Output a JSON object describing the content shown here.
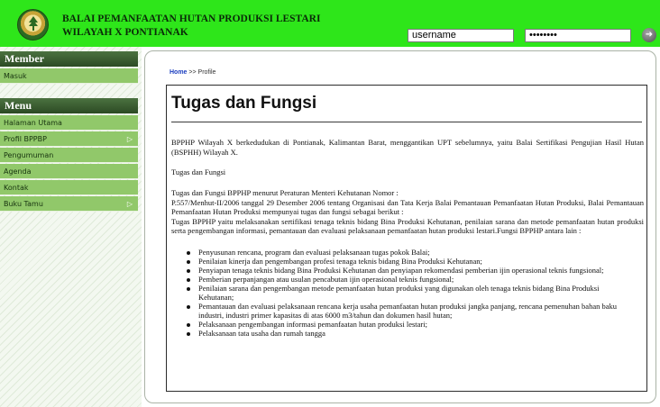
{
  "header": {
    "title_line1": "BALAI PEMANFAATAN HUTAN PRODUKSI LESTARI",
    "title_line2": "WILAYAH X PONTIANAK",
    "username_value": "username",
    "password_value": "••••••••",
    "go_icon": "arrow-right-circle-icon",
    "accent_color": "#2ee61a"
  },
  "sidebar": {
    "member_heading": "Member",
    "member_items": [
      {
        "label": "Masuk"
      }
    ],
    "menu_heading": "Menu",
    "menu_items": [
      {
        "label": "Halaman Utama",
        "has_submenu": false
      },
      {
        "label": "Profil BPPBP",
        "has_submenu": true
      },
      {
        "label": "Pengumuman",
        "has_submenu": false
      },
      {
        "label": "Agenda",
        "has_submenu": false
      },
      {
        "label": "Kontak",
        "has_submenu": false
      },
      {
        "label": "Buku Tamu",
        "has_submenu": true
      }
    ],
    "submenu_arrow": "▷"
  },
  "breadcrumb": {
    "home": "Home",
    "separator": ">>",
    "current": "Profile"
  },
  "article": {
    "title": "Tugas dan Fungsi",
    "p1": "BPPHP Wilayah X berkedudukan di Pontianak, Kalimantan Barat, menggantikan UPT sebelumnya, yaitu Balai Sertifikasi Pengujian Hasil Hutan (BSPHH) Wilayah X.",
    "p2": "Tugas dan Fungsi",
    "p3_line1": "Tugas dan Fungsi BPPHP menurut Peraturan Menteri Kehutanan Nomor :",
    "p3_line2": "P.557/Menhut-II/2006 tanggal 29 Desember 2006 tentang Organisasi dan Tata Kerja Balai Pemantauan Pemanfaatan Hutan Produksi, Balai Pemantauan Pemanfaatan Hutan Produksi mempunyai tugas dan fungsi sebagai berikut :",
    "p3_line3": "Tugas BPPHP yaitu melaksanakan sertifikasi tenaga teknis bidang Bina Produksi Kehutanan, penilaian sarana dan metode pemanfaatan hutan produksi serta pengembangan informasi, pemantauan dan evaluasi pelaksanaan pemanfaatan hutan produksi lestari.Fungsi BPPHP antara lain :",
    "bullets": [
      "Penyusunan rencana, program dan evaluasi pelaksanaan tugas pokok Balai;",
      "Penilaian kinerja dan pengembangan profesi tenaga teknis bidang Bina Produksi Kehutanan;",
      "Penyiapan tenaga teknis bidang Bina Produksi Kehutanan dan penyiapan rekomendasi pemberian ijin operasional teknis fungsional;",
      "Pemberian perpanjangan atau usulan pencabutan ijin operasional teknis fungsional;",
      "Penilaian sarana dan pengembangan metode pemanfaatan hutan produksi yang digunakan oleh tenaga teknis bidang Bina Produksi Kehutanan;",
      "Pemantauan dan evaluasi pelaksanaan rencana kerja usaha pemanfaatan hutan produksi jangka panjang, rencana pemenuhan bahan baku industri, industri primer kapasitas di atas 6000 m3/tahun dan dokumen hasil hutan;",
      "Pelaksanaan pengembangan informasi pemanfaatan hutan produksi lestari;",
      "Pelaksanaan tata usaha dan rumah tangga"
    ]
  }
}
